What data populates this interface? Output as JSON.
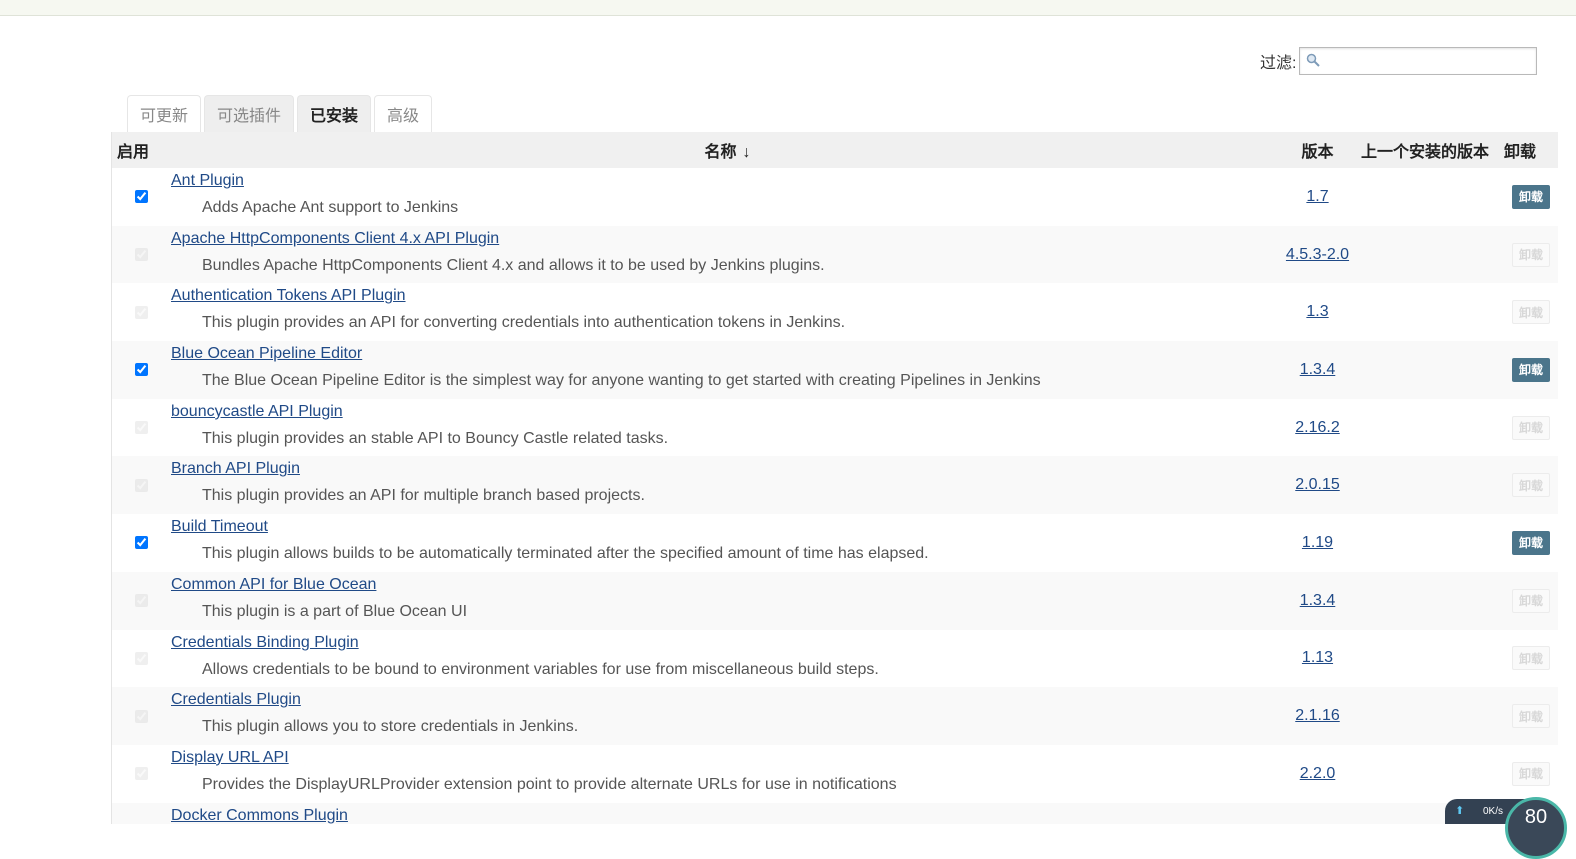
{
  "filter": {
    "label": "过滤:",
    "placeholder": ""
  },
  "tabs": [
    {
      "label": "可更新",
      "state": "normal"
    },
    {
      "label": "可选插件",
      "state": "grey"
    },
    {
      "label": "已安装",
      "state": "active"
    },
    {
      "label": "高级",
      "state": "normal"
    }
  ],
  "table": {
    "headers": {
      "enable": "启用",
      "name": "名称",
      "sort_arrow": "↓",
      "version": "版本",
      "previous": "上一个安装的版本",
      "uninstall": "卸载"
    },
    "uninstall_label": "卸载",
    "rows": [
      {
        "name": "Ant Plugin",
        "desc": "Adds Apache Ant support to Jenkins",
        "version": "1.7",
        "enabled": true,
        "locked": false
      },
      {
        "name": "Apache HttpComponents Client 4.x API Plugin",
        "desc": "Bundles Apache HttpComponents Client 4.x and allows it to be used by Jenkins plugins.",
        "version": "4.5.3-2.0",
        "enabled": true,
        "locked": true
      },
      {
        "name": "Authentication Tokens API Plugin",
        "desc": "This plugin provides an API for converting credentials into authentication tokens in Jenkins.",
        "version": "1.3",
        "enabled": true,
        "locked": true
      },
      {
        "name": "Blue Ocean Pipeline Editor",
        "desc": "The Blue Ocean Pipeline Editor is the simplest way for anyone wanting to get started with creating Pipelines in Jenkins",
        "version": "1.3.4",
        "enabled": true,
        "locked": false
      },
      {
        "name": "bouncycastle API Plugin",
        "desc": "This plugin provides an stable API to Bouncy Castle related tasks.",
        "version": "2.16.2",
        "enabled": true,
        "locked": true
      },
      {
        "name": "Branch API Plugin",
        "desc": "This plugin provides an API for multiple branch based projects.",
        "version": "2.0.15",
        "enabled": true,
        "locked": true
      },
      {
        "name": "Build Timeout",
        "desc": "This plugin allows builds to be automatically terminated after the specified amount of time has elapsed.",
        "version": "1.19",
        "enabled": true,
        "locked": false
      },
      {
        "name": "Common API for Blue Ocean",
        "desc": "This plugin is a part of Blue Ocean UI",
        "version": "1.3.4",
        "enabled": true,
        "locked": true
      },
      {
        "name": "Credentials Binding Plugin",
        "desc": "Allows credentials to be bound to environment variables for use from miscellaneous build steps.",
        "version": "1.13",
        "enabled": true,
        "locked": true
      },
      {
        "name": "Credentials Plugin",
        "desc": "This plugin allows you to store credentials in Jenkins.",
        "version": "2.1.16",
        "enabled": true,
        "locked": true
      },
      {
        "name": "Display URL API",
        "desc": "Provides the DisplayURLProvider extension point to provide alternate URLs for use in notifications",
        "version": "2.2.0",
        "enabled": true,
        "locked": true
      },
      {
        "name": "Docker Commons Plugin",
        "desc": "",
        "version": "",
        "enabled": true,
        "locked": true
      }
    ]
  },
  "speed_widget": {
    "speed": "0K/s",
    "value": "80"
  },
  "colors": {
    "link": "#204a87",
    "uninstall_button": "#4b758b",
    "header_bg": "#f0f0f0"
  }
}
